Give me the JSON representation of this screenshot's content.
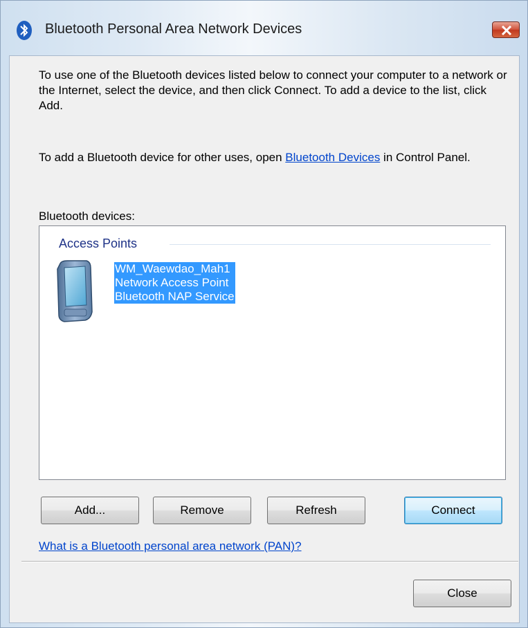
{
  "window": {
    "title": "Bluetooth Personal Area Network Devices",
    "close_glyph": "X"
  },
  "instructions": {
    "paragraph1": "To use one of the Bluetooth devices listed below to connect your computer to a network or the Internet, select the device, and then click Connect. To add a device to the list, click Add.",
    "paragraph2_prefix": "To add a Bluetooth device for other uses, open ",
    "paragraph2_link": "Bluetooth Devices",
    "paragraph2_suffix": " in Control Panel."
  },
  "devices_label": "Bluetooth devices:",
  "list": {
    "group_title": "Access Points",
    "items": [
      {
        "name": "WM_Waewdao_Mah1",
        "type": "Network Access Point",
        "service": "Bluetooth NAP Service",
        "icon": "pda-device-icon",
        "selected": true
      }
    ]
  },
  "buttons": {
    "add": "Add...",
    "remove": "Remove",
    "refresh": "Refresh",
    "connect": "Connect",
    "close": "Close"
  },
  "pan_help_link": "What is a Bluetooth personal area network (PAN)?",
  "colors": {
    "selection": "#3399ff",
    "link": "#0044cc",
    "group_header": "#1e3287"
  }
}
